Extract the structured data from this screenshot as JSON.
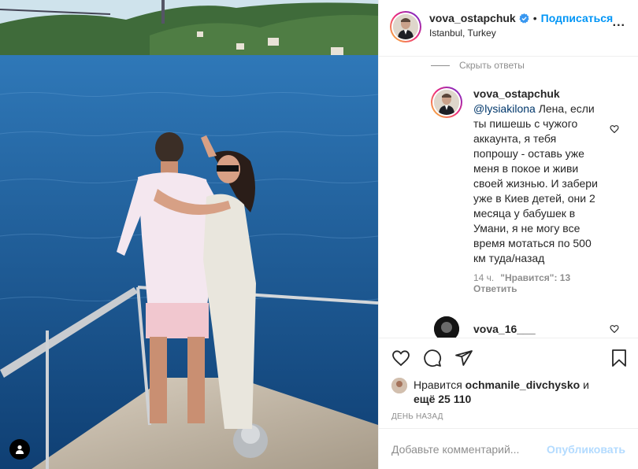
{
  "post": {
    "author": {
      "username": "vova_ostapchuk",
      "verified": true,
      "follow_label": "Подписаться",
      "location": "Istanbul, Turkey",
      "more_label": "..."
    },
    "hide_replies_label": "Скрыть ответы",
    "reply": {
      "username": "vova_ostapchuk",
      "mention": "@lysiakilona",
      "text": " Лена, если ты пишешь с чужого аккаунта, я тебя попрошу - оставь уже меня в покое и живи своей жизнью. И забери уже в Киев детей, они 2 месяца у бабушек в Умани, я не могу все время мотаться по 500 км туда/назад",
      "time": "14 ч.",
      "likes": "\"Нравится\": 13",
      "answer_label": "Ответить"
    },
    "next_reply": {
      "username": "vova_16___"
    },
    "likes": {
      "prefix": "Нравится ",
      "user": "ochmanile_divchysko",
      "suffix": " и",
      "more": "ещё 25 110"
    },
    "date": "ДЕНЬ НАЗАД",
    "comment_input": {
      "placeholder": "Добавьте комментарий...",
      "publish_label": "Опубликовать"
    },
    "colors": {
      "accent": "#0095f6",
      "muted": "#8e8e8e",
      "publish_disabled": "#b3dbff"
    }
  }
}
